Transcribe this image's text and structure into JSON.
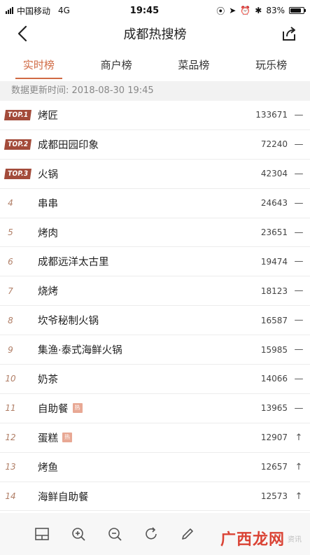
{
  "status": {
    "carrier": "中国移动",
    "network": "4G",
    "time": "19:45",
    "battery": "83%",
    "battery_level": 0.83
  },
  "nav": {
    "title": "成都热搜榜"
  },
  "tabs": [
    {
      "label": "实时榜",
      "active": true
    },
    {
      "label": "商户榜",
      "active": false
    },
    {
      "label": "菜品榜",
      "active": false
    },
    {
      "label": "玩乐榜",
      "active": false
    }
  ],
  "update_text": "数据更新时间: 2018-08-30 19:45",
  "items": [
    {
      "rank": "TOP.1",
      "top": true,
      "name": "烤匠",
      "hot": "",
      "count": "133671",
      "trend": "—"
    },
    {
      "rank": "TOP.2",
      "top": true,
      "name": "成都田园印象",
      "hot": "",
      "count": "72240",
      "trend": "—"
    },
    {
      "rank": "TOP.3",
      "top": true,
      "name": "火锅",
      "hot": "",
      "count": "42304",
      "trend": "—"
    },
    {
      "rank": "4",
      "top": false,
      "name": "串串",
      "hot": "",
      "count": "24643",
      "trend": "—"
    },
    {
      "rank": "5",
      "top": false,
      "name": "烤肉",
      "hot": "",
      "count": "23651",
      "trend": "—"
    },
    {
      "rank": "6",
      "top": false,
      "name": "成都远洋太古里",
      "hot": "",
      "count": "19474",
      "trend": "—"
    },
    {
      "rank": "7",
      "top": false,
      "name": "烧烤",
      "hot": "",
      "count": "18123",
      "trend": "—"
    },
    {
      "rank": "8",
      "top": false,
      "name": "坎爷秘制火锅",
      "hot": "",
      "count": "16587",
      "trend": "—"
    },
    {
      "rank": "9",
      "top": false,
      "name": "集渔·泰式海鲜火锅",
      "hot": "",
      "count": "15985",
      "trend": "—"
    },
    {
      "rank": "10",
      "top": false,
      "name": "奶茶",
      "hot": "",
      "count": "14066",
      "trend": "—"
    },
    {
      "rank": "11",
      "top": false,
      "name": "自助餐",
      "hot": "热",
      "count": "13965",
      "trend": "—"
    },
    {
      "rank": "12",
      "top": false,
      "name": "蛋糕",
      "hot": "热",
      "count": "12907",
      "trend": "↑"
    },
    {
      "rank": "13",
      "top": false,
      "name": "烤鱼",
      "hot": "",
      "count": "12657",
      "trend": "↑"
    },
    {
      "rank": "14",
      "top": false,
      "name": "海鲜自助餐",
      "hot": "",
      "count": "12573",
      "trend": "↑"
    }
  ],
  "toolbar": {
    "buttons": [
      "layout-icon",
      "zoom-in-icon",
      "zoom-out-icon",
      "refresh-icon",
      "edit-icon"
    ]
  },
  "watermark": {
    "logo": "广西龙网",
    "sub": "资讯"
  },
  "colors": {
    "accent": "#d06a44",
    "top_badge": "#a34b3a",
    "hot_badge": "#e8a894"
  }
}
